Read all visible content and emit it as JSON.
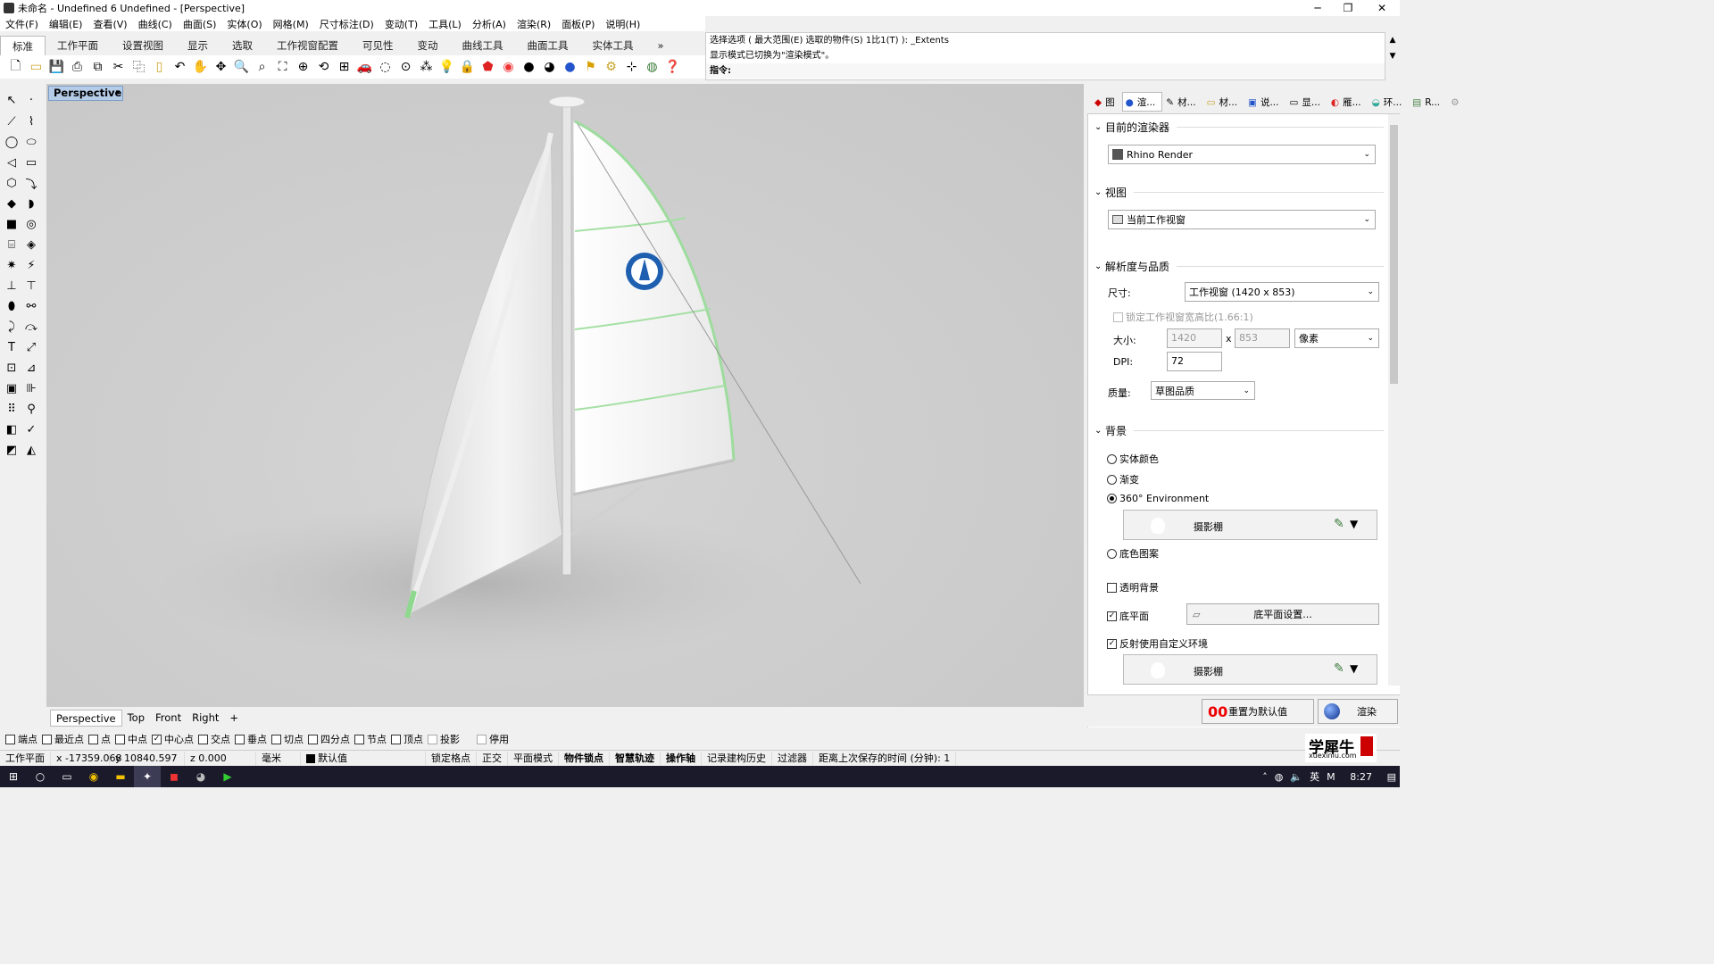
{
  "window": {
    "title": "未命名 - Undefined 6 Undefined - [Perspective]",
    "minimize": "─",
    "restore": "❐",
    "close": "✕"
  },
  "menu": [
    "文件(F)",
    "编辑(E)",
    "查看(V)",
    "曲线(C)",
    "曲面(S)",
    "实体(O)",
    "网格(M)",
    "尺寸标注(D)",
    "变动(T)",
    "工具(L)",
    "分析(A)",
    "渲染(R)",
    "面板(P)",
    "说明(H)"
  ],
  "command": {
    "history1": "选择选项 ( 最大范围(E) 选取的物件(S) 1比1(T) ): _Extents",
    "history2": "显示模式已切换为\"渲染模式\"。",
    "prompt": "指令: "
  },
  "toolbar_tabs": [
    "标准",
    "工作平面",
    "设置视图",
    "显示",
    "选取",
    "工作视窗配置",
    "可见性",
    "变动",
    "曲线工具",
    "曲面工具",
    "实体工具",
    "»"
  ],
  "toolbar_icons": [
    "new-icon",
    "open-icon",
    "save-icon",
    "print-icon",
    "import-icon",
    "cut-icon",
    "copy-icon",
    "paste-icon",
    "undo-icon",
    "pan-icon",
    "rotate-view-icon",
    "zoom-icon",
    "zoom-window-icon",
    "zoom-extents-icon",
    "zoom-selected-icon",
    "rotate-icon",
    "four-view-icon",
    "car-icon",
    "hide-icon",
    "show-icon",
    "select-icon",
    "light-icon",
    "lock-icon",
    "material-icon",
    "color-icon",
    "shade-icon",
    "render-icon",
    "sphere-icon",
    "flag-icon",
    "gear-icon",
    "grid-icon",
    "earth-icon",
    "help-icon"
  ],
  "viewport": {
    "name": "Perspective",
    "tabs": [
      "Perspective",
      "Top",
      "Front",
      "Right"
    ],
    "add_tab": "+"
  },
  "osnaps": [
    {
      "label": "端点",
      "checked": false
    },
    {
      "label": "最近点",
      "checked": false
    },
    {
      "label": "点",
      "checked": false
    },
    {
      "label": "中点",
      "checked": false
    },
    {
      "label": "中心点",
      "checked": true
    },
    {
      "label": "交点",
      "checked": false
    },
    {
      "label": "垂点",
      "checked": false
    },
    {
      "label": "切点",
      "checked": false
    },
    {
      "label": "四分点",
      "checked": false
    },
    {
      "label": "节点",
      "checked": false
    },
    {
      "label": "顶点",
      "checked": false
    },
    {
      "label": "投影",
      "checked": false
    },
    {
      "label": "停用",
      "checked": false
    }
  ],
  "status": {
    "plane": "工作平面",
    "x": "x -17359.068",
    "y": "y 10840.597",
    "z": "z 0.000",
    "unit": "毫米",
    "layer": "默认值",
    "items": [
      "锁定格点",
      "正交",
      "平面模式",
      "物件锁点",
      "智慧轨迹",
      "操作轴",
      "记录建构历史",
      "过滤器"
    ],
    "bold_items": [
      "物件锁点",
      "智慧轨迹",
      "操作轴"
    ],
    "save_time": "距离上次保存的时间 (分钟): 1"
  },
  "panel": {
    "tabs": [
      "图",
      "渲...",
      "材...",
      "材...",
      "说...",
      "显...",
      "雁...",
      "环...",
      "R..."
    ],
    "renderer_section": "目前的渲染器",
    "renderer_value": "Rhino Render",
    "view_section": "视图",
    "view_value": "当前工作视窗",
    "resolution_section": "解析度与品质",
    "size_label": "尺寸:",
    "size_value": "工作视窗 (1420 x 853)",
    "lock_ratio": "锁定工作视窗宽高比(1.66:1)",
    "dims_label": "大小:",
    "width": "1420",
    "times": "x",
    "height": "853",
    "unit_value": "像素",
    "dpi_label": "DPI:",
    "dpi_value": "72",
    "quality_label": "质量:",
    "quality_value": "草图品质",
    "background_section": "背景",
    "bg_options": [
      {
        "label": "实体颜色",
        "selected": false
      },
      {
        "label": "渐变",
        "selected": false
      },
      {
        "label": "360° Environment",
        "selected": true
      },
      {
        "label": "底色图案",
        "selected": false
      }
    ],
    "env_name": "摄影棚",
    "transparent_bg": "透明背景",
    "ground_plane": "底平面",
    "ground_settings": "底平面设置...",
    "reflection_custom": "反射使用自定义环境",
    "env_name2": "摄影棚",
    "reset_button": "重置为默认值",
    "render_button": "渲染"
  },
  "watermark": {
    "text": "学犀牛",
    "url": "xuexiniu.com"
  },
  "taskbar": {
    "lang": "英",
    "ime": "M",
    "time": "8:27"
  }
}
